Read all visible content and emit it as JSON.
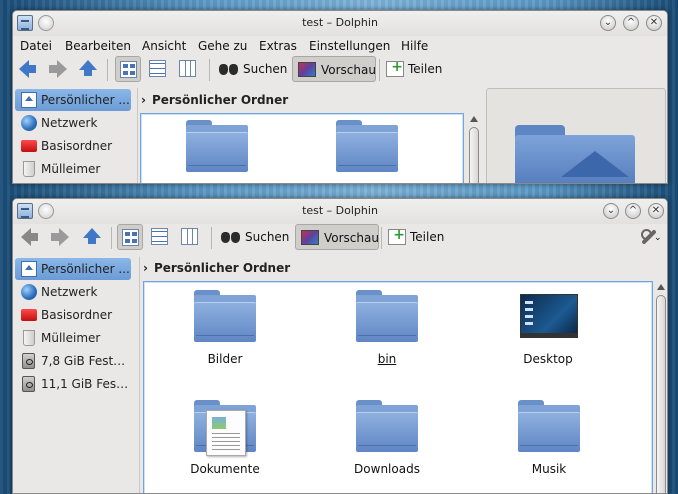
{
  "window_back": {
    "title": "test – Dolphin",
    "menu": [
      "Datei",
      "Bearbeiten",
      "Ansicht",
      "Gehe zu",
      "Extras",
      "Einstellungen",
      "Hilfe"
    ],
    "toolbar": {
      "search": "Suchen",
      "preview": "Vorschau",
      "split": "Teilen"
    },
    "places": [
      "Persönlicher ...",
      "Netzwerk",
      "Basisordner",
      "Mülleimer"
    ],
    "breadcrumb": "Persönlicher Ordner",
    "close_glyph": "✕",
    "maximize_glyph": "^",
    "minimize_glyph": "⌄"
  },
  "window_front": {
    "title": "test – Dolphin",
    "toolbar": {
      "search": "Suchen",
      "preview": "Vorschau",
      "split": "Teilen"
    },
    "places": [
      "Persönlicher ...",
      "Netzwerk",
      "Basisordner",
      "Mülleimer",
      "7,8 GiB Festpl...",
      "11,1 GiB Festp..."
    ],
    "breadcrumb": "Persönlicher Ordner",
    "items": [
      "Bilder",
      "bin",
      "Desktop",
      "Dokumente",
      "Downloads",
      "Musik"
    ],
    "close_glyph": "✕",
    "maximize_glyph": "^",
    "minimize_glyph": "⌄",
    "config_glyph": "⌄"
  },
  "icons": {
    "back": "arrow-left-icon",
    "forward": "arrow-right-icon",
    "up": "arrow-up-icon",
    "icons_view": "icons-view-icon",
    "details_view": "details-view-icon",
    "columns_view": "columns-view-icon",
    "search": "binoculars-icon",
    "preview": "preview-icon",
    "split": "split-icon",
    "config": "wrench-icon"
  },
  "colors": {
    "selection": "#7aa8de",
    "folder": "#7fa3d6",
    "accent_blue": "#3e78c6",
    "view_border": "#70a6df"
  }
}
